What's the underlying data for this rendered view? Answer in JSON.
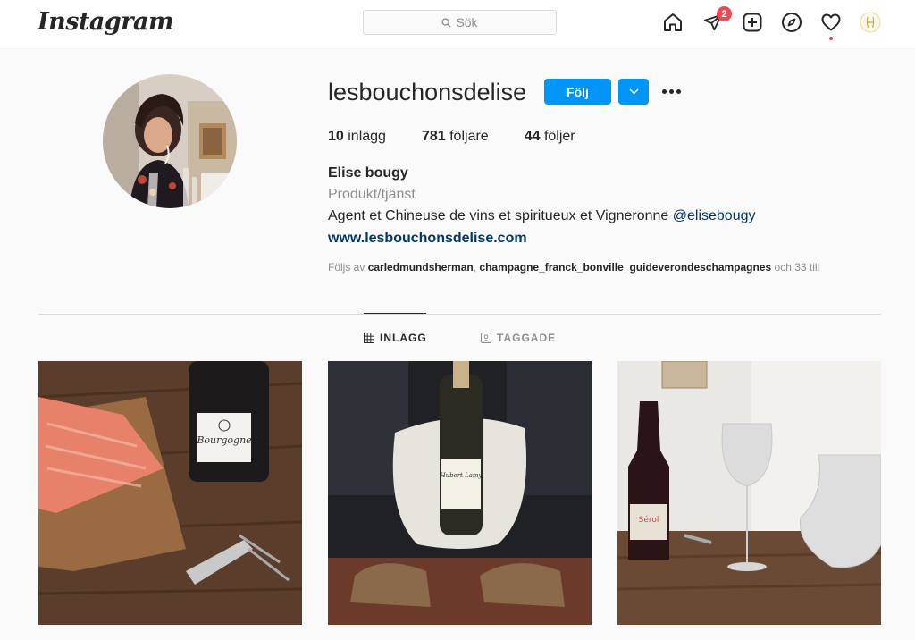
{
  "app": {
    "logo": "Instagram",
    "search_placeholder": "Sök",
    "notification_count": "2",
    "nav_icons": [
      "home-icon",
      "direct-icon",
      "new-post-icon",
      "explore-icon",
      "activity-icon",
      "profile-avatar"
    ]
  },
  "profile": {
    "username": "lesbouchonsdelise",
    "follow_label": "Följ",
    "stats": {
      "posts_count": "10",
      "posts_label": "inlägg",
      "followers_count": "781",
      "followers_label": "följare",
      "following_count": "44",
      "following_label": "följer"
    },
    "full_name": "Elise bougy",
    "category": "Produkt/tjänst",
    "bio_text": "Agent et Chineuse de vins et spiritueux et Vigneronne",
    "bio_mention": "@elisebougy",
    "website": "www.lesbouchonsdelise.com",
    "followed_by_prefix": "Följs av",
    "followed_by_users": [
      "carledmundsherman",
      "champagne_franck_bonville",
      "guideverondeschampagnes"
    ],
    "followed_by_suffix": "och 33 till"
  },
  "tabs": {
    "posts_label": "INLÄGG",
    "tagged_label": "TAGGADE"
  },
  "colors": {
    "accent": "#0095f6",
    "badge": "#ed4956",
    "link": "#00376b"
  }
}
